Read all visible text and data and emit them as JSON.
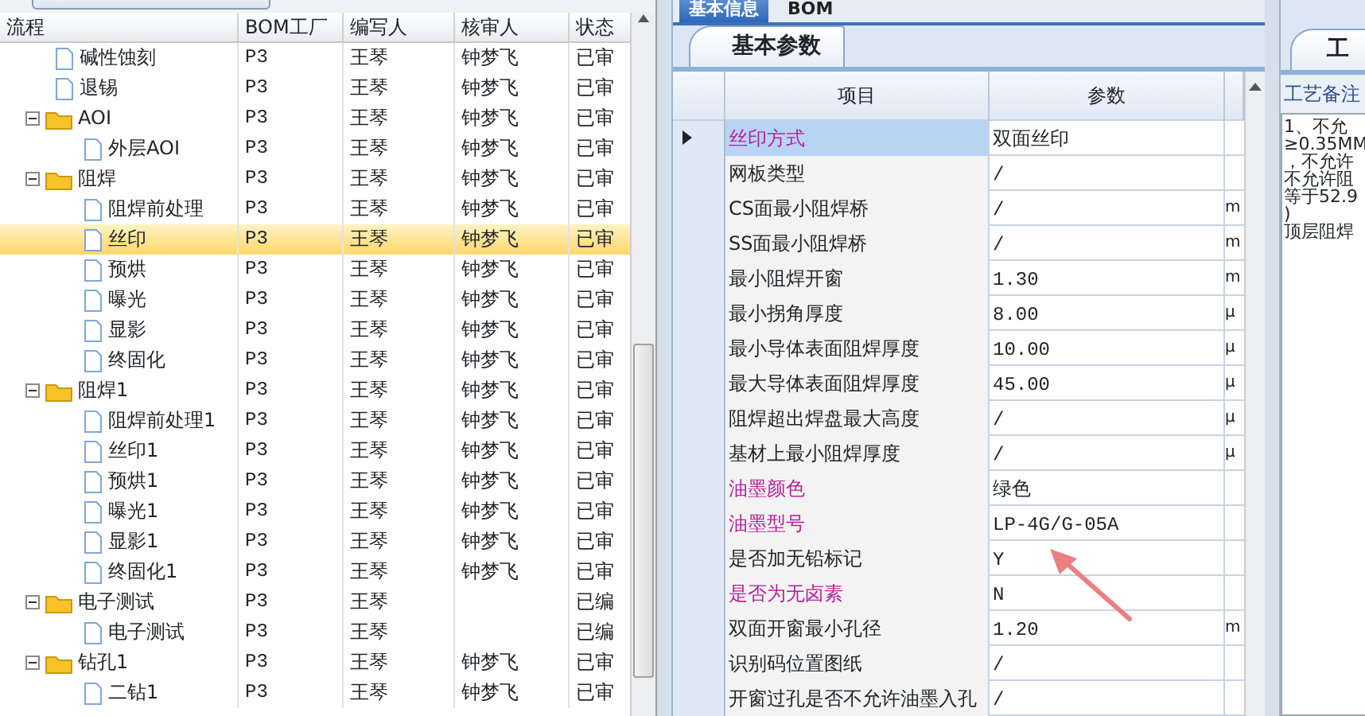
{
  "tree": {
    "columns": [
      "流程",
      "BOM工厂",
      "编写人",
      "核审人",
      "状态"
    ],
    "rows": [
      {
        "kind": "leaf",
        "label": "碱性蚀刻",
        "factory": "P3",
        "writer": "王琴",
        "reviewer": "钟梦飞",
        "status": "已审",
        "selected": false
      },
      {
        "kind": "leaf",
        "label": "退锡",
        "factory": "P3",
        "writer": "王琴",
        "reviewer": "钟梦飞",
        "status": "已审",
        "selected": false
      },
      {
        "kind": "folder",
        "label": "AOI",
        "factory": "P3",
        "writer": "王琴",
        "reviewer": "钟梦飞",
        "status": "已审",
        "selected": false,
        "expanded": true,
        "children": [
          {
            "kind": "leaf",
            "label": "外层AOI",
            "factory": "P3",
            "writer": "王琴",
            "reviewer": "钟梦飞",
            "status": "已审",
            "selected": false
          }
        ]
      },
      {
        "kind": "folder",
        "label": "阻焊",
        "factory": "P3",
        "writer": "王琴",
        "reviewer": "钟梦飞",
        "status": "已审",
        "selected": false,
        "expanded": true,
        "children": [
          {
            "kind": "leaf",
            "label": "阻焊前处理",
            "factory": "P3",
            "writer": "王琴",
            "reviewer": "钟梦飞",
            "status": "已审",
            "selected": false
          },
          {
            "kind": "leaf",
            "label": "丝印",
            "factory": "P3",
            "writer": "王琴",
            "reviewer": "钟梦飞",
            "status": "已审",
            "selected": true
          },
          {
            "kind": "leaf",
            "label": "预烘",
            "factory": "P3",
            "writer": "王琴",
            "reviewer": "钟梦飞",
            "status": "已审",
            "selected": false
          },
          {
            "kind": "leaf",
            "label": "曝光",
            "factory": "P3",
            "writer": "王琴",
            "reviewer": "钟梦飞",
            "status": "已审",
            "selected": false
          },
          {
            "kind": "leaf",
            "label": "显影",
            "factory": "P3",
            "writer": "王琴",
            "reviewer": "钟梦飞",
            "status": "已审",
            "selected": false
          },
          {
            "kind": "leaf",
            "label": "终固化",
            "factory": "P3",
            "writer": "王琴",
            "reviewer": "钟梦飞",
            "status": "已审",
            "selected": false
          }
        ]
      },
      {
        "kind": "folder",
        "label": "阻焊1",
        "factory": "P3",
        "writer": "王琴",
        "reviewer": "钟梦飞",
        "status": "已审",
        "selected": false,
        "expanded": true,
        "children": [
          {
            "kind": "leaf",
            "label": "阻焊前处理1",
            "factory": "P3",
            "writer": "王琴",
            "reviewer": "钟梦飞",
            "status": "已审",
            "selected": false
          },
          {
            "kind": "leaf",
            "label": "丝印1",
            "factory": "P3",
            "writer": "王琴",
            "reviewer": "钟梦飞",
            "status": "已审",
            "selected": false
          },
          {
            "kind": "leaf",
            "label": "预烘1",
            "factory": "P3",
            "writer": "王琴",
            "reviewer": "钟梦飞",
            "status": "已审",
            "selected": false
          },
          {
            "kind": "leaf",
            "label": "曝光1",
            "factory": "P3",
            "writer": "王琴",
            "reviewer": "钟梦飞",
            "status": "已审",
            "selected": false
          },
          {
            "kind": "leaf",
            "label": "显影1",
            "factory": "P3",
            "writer": "王琴",
            "reviewer": "钟梦飞",
            "status": "已审",
            "selected": false
          },
          {
            "kind": "leaf",
            "label": "终固化1",
            "factory": "P3",
            "writer": "王琴",
            "reviewer": "钟梦飞",
            "status": "已审",
            "selected": false
          }
        ]
      },
      {
        "kind": "folder",
        "label": "电子测试",
        "factory": "P3",
        "writer": "王琴",
        "status": "已编",
        "selected": false,
        "expanded": true,
        "children": [
          {
            "kind": "leaf",
            "label": "电子测试",
            "factory": "P3",
            "writer": "王琴",
            "status": "已编",
            "selected": false
          }
        ]
      },
      {
        "kind": "folder",
        "label": "钻孔1",
        "factory": "P3",
        "writer": "王琴",
        "reviewer": "钟梦飞",
        "status": "已审",
        "selected": false,
        "expanded": true,
        "children": [
          {
            "kind": "leaf",
            "label": "二钻1",
            "factory": "P3",
            "writer": "王琴",
            "reviewer": "钟梦飞",
            "status": "已审",
            "selected": false
          }
        ]
      }
    ]
  },
  "tabs": [
    {
      "label": "基本信息",
      "selected": true
    },
    {
      "label": "BOM",
      "selected": false
    }
  ],
  "sub_tab": {
    "label": "基本参数"
  },
  "param_grid": {
    "columns": [
      "项目",
      "参数"
    ],
    "rows": [
      {
        "name": "丝印方式",
        "value": "双面丝印",
        "required": true,
        "selected": true
      },
      {
        "name": "网板类型",
        "value": "/",
        "required": false,
        "selected": false
      },
      {
        "name": "CS面最小阻焊桥",
        "value": "/",
        "unit": "m",
        "required": false,
        "selected": false
      },
      {
        "name": "SS面最小阻焊桥",
        "value": "/",
        "unit": "m",
        "required": false,
        "selected": false
      },
      {
        "name": "最小阻焊开窗",
        "value": "1.30",
        "unit": "m",
        "required": false,
        "selected": false
      },
      {
        "name": "最小拐角厚度",
        "value": "8.00",
        "unit": "μ",
        "required": false,
        "selected": false
      },
      {
        "name": "最小导体表面阻焊厚度",
        "value": "10.00",
        "unit": "μ",
        "required": false,
        "selected": false
      },
      {
        "name": "最大导体表面阻焊厚度",
        "value": "45.00",
        "unit": "μ",
        "required": false,
        "selected": false
      },
      {
        "name": "阻焊超出焊盘最大高度",
        "value": "/",
        "unit": "μ",
        "required": false,
        "selected": false
      },
      {
        "name": "基材上最小阻焊厚度",
        "value": "/",
        "unit": "μ",
        "required": false,
        "selected": false
      },
      {
        "name": "油墨颜色",
        "value": "绿色",
        "required": true,
        "selected": false
      },
      {
        "name": "油墨型号",
        "value": "LP-4G/G-05A",
        "required": true,
        "selected": false
      },
      {
        "name": "是否加无铅标记",
        "value": "Y",
        "required": false,
        "selected": false
      },
      {
        "name": "是否为无卤素",
        "value": "N",
        "required": true,
        "selected": false
      },
      {
        "name": "双面开窗最小孔径",
        "value": "1.20",
        "unit": "m",
        "required": false,
        "selected": false
      },
      {
        "name": "识别码位置图纸",
        "value": "/",
        "required": false,
        "selected": false
      },
      {
        "name": "开窗过孔是否不允许油墨入孔",
        "value": "/",
        "required": false,
        "selected": false
      }
    ]
  },
  "remarks": {
    "tab": "工",
    "label": "工艺备注",
    "lines": [
      "1、不允",
      "≥0.35MM",
      "，不允许",
      "不允许阻",
      "等于52.9",
      ")",
      "顶层阻焊"
    ]
  }
}
